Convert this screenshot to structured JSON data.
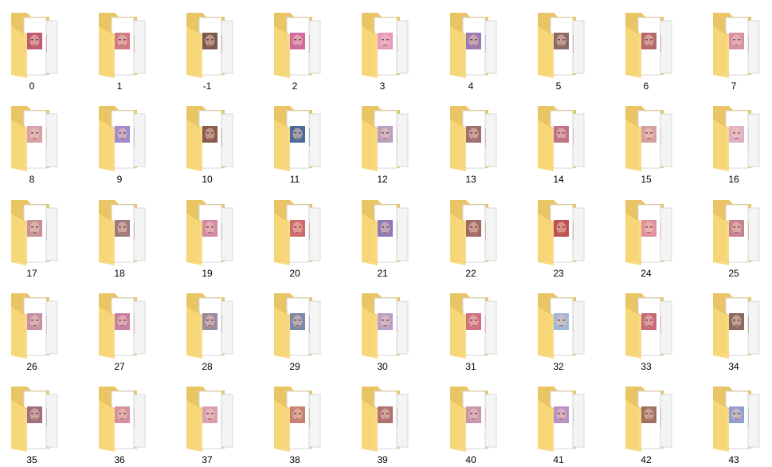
{
  "view": "folder-large-icons",
  "folders": [
    {
      "label": "0",
      "tint": "#c25a6e"
    },
    {
      "label": "1",
      "tint": "#d07a86"
    },
    {
      "label": "-1",
      "tint": "#7a5a4e"
    },
    {
      "label": "2",
      "tint": "#d06aa0"
    },
    {
      "label": "3",
      "tint": "#e89ac0"
    },
    {
      "label": "4",
      "tint": "#9a7ab0"
    },
    {
      "label": "5",
      "tint": "#8a6a66"
    },
    {
      "label": "6",
      "tint": "#b46a6a"
    },
    {
      "label": "7",
      "tint": "#d890a8"
    },
    {
      "label": "8",
      "tint": "#d8a0a8"
    },
    {
      "label": "9",
      "tint": "#a08ad0"
    },
    {
      "label": "10",
      "tint": "#8a5a4a"
    },
    {
      "label": "11",
      "tint": "#4a6a9a"
    },
    {
      "label": "12",
      "tint": "#b8a0c0"
    },
    {
      "label": "13",
      "tint": "#a07070"
    },
    {
      "label": "14",
      "tint": "#c07088"
    },
    {
      "label": "15",
      "tint": "#d4a0a0"
    },
    {
      "label": "16",
      "tint": "#e0b0c8"
    },
    {
      "label": "17",
      "tint": "#c89098"
    },
    {
      "label": "18",
      "tint": "#a07a7a"
    },
    {
      "label": "19",
      "tint": "#d48aa0"
    },
    {
      "label": "20",
      "tint": "#d06a6a"
    },
    {
      "label": "21",
      "tint": "#8a7ab8"
    },
    {
      "label": "22",
      "tint": "#a06a60"
    },
    {
      "label": "23",
      "tint": "#c05050"
    },
    {
      "label": "24",
      "tint": "#e0909a"
    },
    {
      "label": "25",
      "tint": "#c88090"
    },
    {
      "label": "26",
      "tint": "#c890a8"
    },
    {
      "label": "27",
      "tint": "#c880a8"
    },
    {
      "label": "28",
      "tint": "#9a8aa0"
    },
    {
      "label": "29",
      "tint": "#7a8aa8"
    },
    {
      "label": "30",
      "tint": "#b8a0c8"
    },
    {
      "label": "31",
      "tint": "#d07080"
    },
    {
      "label": "32",
      "tint": "#a0b8d8"
    },
    {
      "label": "33",
      "tint": "#c86a78"
    },
    {
      "label": "34",
      "tint": "#8a6a60"
    },
    {
      "label": "35",
      "tint": "#a07080"
    },
    {
      "label": "36",
      "tint": "#d890a0"
    },
    {
      "label": "37",
      "tint": "#d8a0b0"
    },
    {
      "label": "38",
      "tint": "#c88070"
    },
    {
      "label": "39",
      "tint": "#b07070"
    },
    {
      "label": "40",
      "tint": "#c898b0"
    },
    {
      "label": "41",
      "tint": "#b890c8"
    },
    {
      "label": "42",
      "tint": "#a07060"
    },
    {
      "label": "43",
      "tint": "#90a0d0"
    }
  ]
}
